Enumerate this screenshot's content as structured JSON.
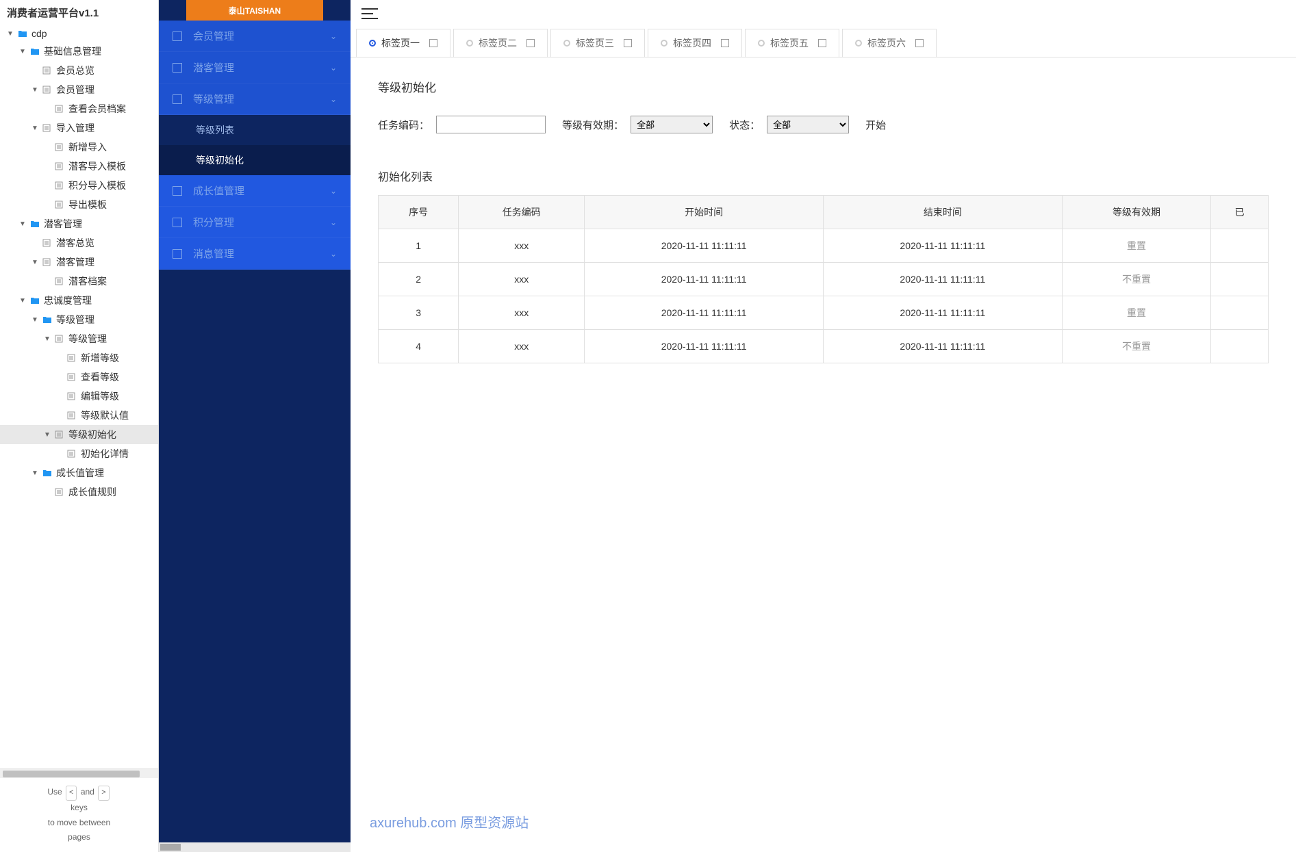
{
  "leftPanel": {
    "title": "消费者运营平台v1.1",
    "help": {
      "use": "Use",
      "and": "and",
      "keys": "keys",
      "move": "to move between",
      "pages": "pages",
      "k1": "<",
      "k2": ">"
    }
  },
  "tree": [
    {
      "indent": 0,
      "toggle": "▼",
      "icon": "folder",
      "label": "cdp"
    },
    {
      "indent": 1,
      "toggle": "▼",
      "icon": "folder",
      "label": "基础信息管理"
    },
    {
      "indent": 2,
      "toggle": "",
      "icon": "file",
      "label": "会员总览"
    },
    {
      "indent": 2,
      "toggle": "▼",
      "icon": "file",
      "label": "会员管理"
    },
    {
      "indent": 3,
      "toggle": "",
      "icon": "file",
      "label": "查看会员档案"
    },
    {
      "indent": 2,
      "toggle": "▼",
      "icon": "file",
      "label": "导入管理"
    },
    {
      "indent": 3,
      "toggle": "",
      "icon": "file",
      "label": "新增导入"
    },
    {
      "indent": 3,
      "toggle": "",
      "icon": "file",
      "label": "潜客导入模板"
    },
    {
      "indent": 3,
      "toggle": "",
      "icon": "file",
      "label": "积分导入模板"
    },
    {
      "indent": 3,
      "toggle": "",
      "icon": "file",
      "label": "导出模板"
    },
    {
      "indent": 1,
      "toggle": "▼",
      "icon": "folder",
      "label": "潜客管理"
    },
    {
      "indent": 2,
      "toggle": "",
      "icon": "file",
      "label": "潜客总览"
    },
    {
      "indent": 2,
      "toggle": "▼",
      "icon": "file",
      "label": "潜客管理"
    },
    {
      "indent": 3,
      "toggle": "",
      "icon": "file",
      "label": "潜客档案"
    },
    {
      "indent": 1,
      "toggle": "▼",
      "icon": "folder",
      "label": "忠诚度管理"
    },
    {
      "indent": 2,
      "toggle": "▼",
      "icon": "folder",
      "label": "等级管理"
    },
    {
      "indent": 3,
      "toggle": "▼",
      "icon": "file",
      "label": "等级管理"
    },
    {
      "indent": 4,
      "toggle": "",
      "icon": "file",
      "label": "新增等级"
    },
    {
      "indent": 4,
      "toggle": "",
      "icon": "file",
      "label": "查看等级"
    },
    {
      "indent": 4,
      "toggle": "",
      "icon": "file",
      "label": "编辑等级"
    },
    {
      "indent": 4,
      "toggle": "",
      "icon": "file",
      "label": "等级默认值"
    },
    {
      "indent": 3,
      "toggle": "▼",
      "icon": "file",
      "label": "等级初始化",
      "selected": true
    },
    {
      "indent": 4,
      "toggle": "",
      "icon": "file",
      "label": "初始化详情"
    },
    {
      "indent": 2,
      "toggle": "▼",
      "icon": "folder",
      "label": "成长值管理"
    },
    {
      "indent": 3,
      "toggle": "",
      "icon": "file",
      "label": "成长值规则"
    }
  ],
  "logo": {
    "main": "泰山TAISHAN",
    "sub": "TAISHAN"
  },
  "nav": [
    {
      "type": "item",
      "label": "会员管理",
      "cls": "blue",
      "chev": true
    },
    {
      "type": "item",
      "label": "潜客管理",
      "cls": "blue",
      "chev": true
    },
    {
      "type": "item",
      "label": "等级管理",
      "cls": "blue",
      "chev": true
    },
    {
      "type": "sub",
      "label": "等级列表"
    },
    {
      "type": "sub",
      "label": "等级初始化",
      "active": true
    },
    {
      "type": "item",
      "label": "成长值管理",
      "cls": "blue2",
      "chev": true
    },
    {
      "type": "item",
      "label": "积分管理",
      "cls": "blue2",
      "chev": true
    },
    {
      "type": "item",
      "label": "消息管理",
      "cls": "blue2",
      "chev": true
    }
  ],
  "tabs": [
    {
      "label": "标签页一",
      "active": true
    },
    {
      "label": "标签页二"
    },
    {
      "label": "标签页三"
    },
    {
      "label": "标签页四"
    },
    {
      "label": "标签页五"
    },
    {
      "label": "标签页六"
    }
  ],
  "page": {
    "title": "等级初始化",
    "filters": {
      "code": "任务编码",
      "validity": "等级有效期",
      "status": "状态",
      "start": "开始",
      "optAll": "全部"
    },
    "listTitle": "初始化列表",
    "headers": [
      "序号",
      "任务编码",
      "开始时间",
      "结束时间",
      "等级有效期",
      "已"
    ],
    "rows": [
      {
        "no": "1",
        "code": "xxx",
        "start": "2020-11-11 11:11:11",
        "end": "2020-11-11 11:11:11",
        "validity": "重置"
      },
      {
        "no": "2",
        "code": "xxx",
        "start": "2020-11-11 11:11:11",
        "end": "2020-11-11 11:11:11",
        "validity": "不重置"
      },
      {
        "no": "3",
        "code": "xxx",
        "start": "2020-11-11 11:11:11",
        "end": "2020-11-11 11:11:11",
        "validity": "重置"
      },
      {
        "no": "4",
        "code": "xxx",
        "start": "2020-11-11 11:11:11",
        "end": "2020-11-11 11:11:11",
        "validity": "不重置"
      }
    ]
  },
  "watermark": "axurehub.com 原型资源站"
}
